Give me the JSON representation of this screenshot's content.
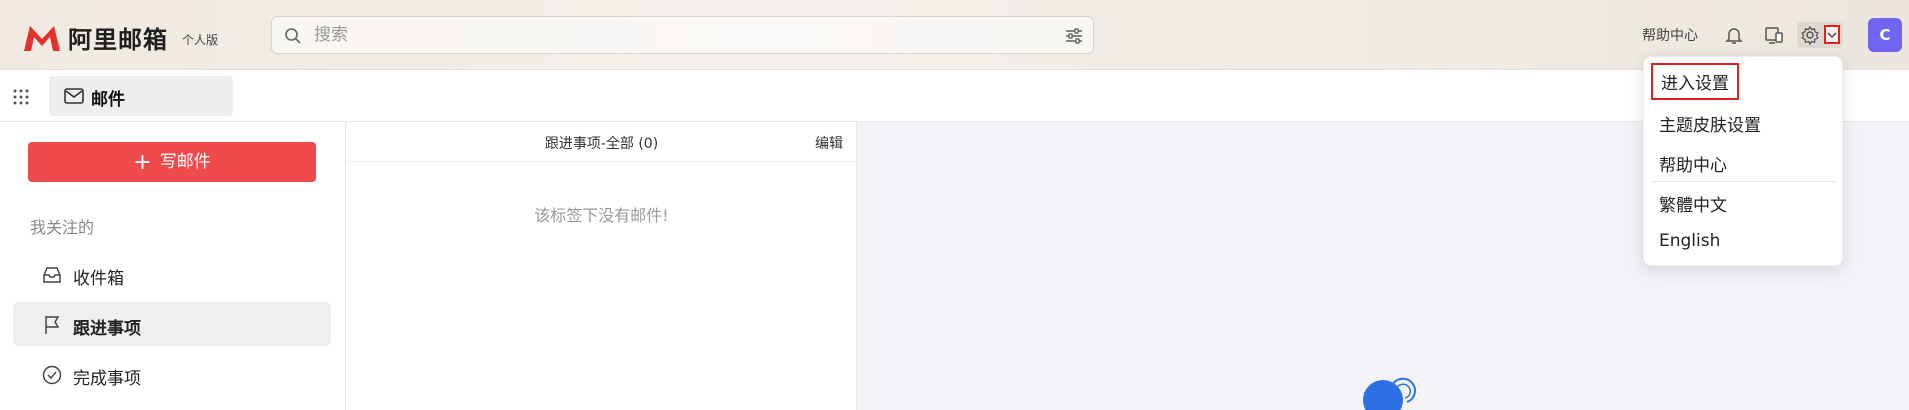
{
  "header": {
    "logo_text": "阿里邮箱",
    "logo_sub": "个人版",
    "search_placeholder": "搜索",
    "help_link": "帮助中心",
    "avatar_initial": "C"
  },
  "tabs": [
    {
      "label": "邮件"
    }
  ],
  "sidebar": {
    "compose_label": "写邮件",
    "section_title": "我关注的",
    "items": [
      {
        "label": "收件箱"
      },
      {
        "label": "跟进事项"
      },
      {
        "label": "完成事项"
      }
    ]
  },
  "list": {
    "title": "跟进事项-全部 (0)",
    "edit_label": "编辑",
    "empty_message": "该标签下没有邮件!"
  },
  "settings_menu": {
    "items": [
      {
        "label": "进入设置"
      },
      {
        "label": "主题皮肤设置"
      },
      {
        "label": "帮助中心"
      },
      {
        "label": "繁體中文"
      },
      {
        "label": "English"
      }
    ]
  },
  "colors": {
    "brand_red": "#ef4b4b",
    "avatar_purple": "#7065f0",
    "highlight_red": "#e02020"
  },
  "icons": [
    "logo-icon",
    "search-icon",
    "filter-icon",
    "bell-icon",
    "devices-icon",
    "gear-icon",
    "chevron-down-icon",
    "apps-grid-icon",
    "mail-icon",
    "inbox-icon",
    "flag-icon",
    "check-circle-icon"
  ]
}
